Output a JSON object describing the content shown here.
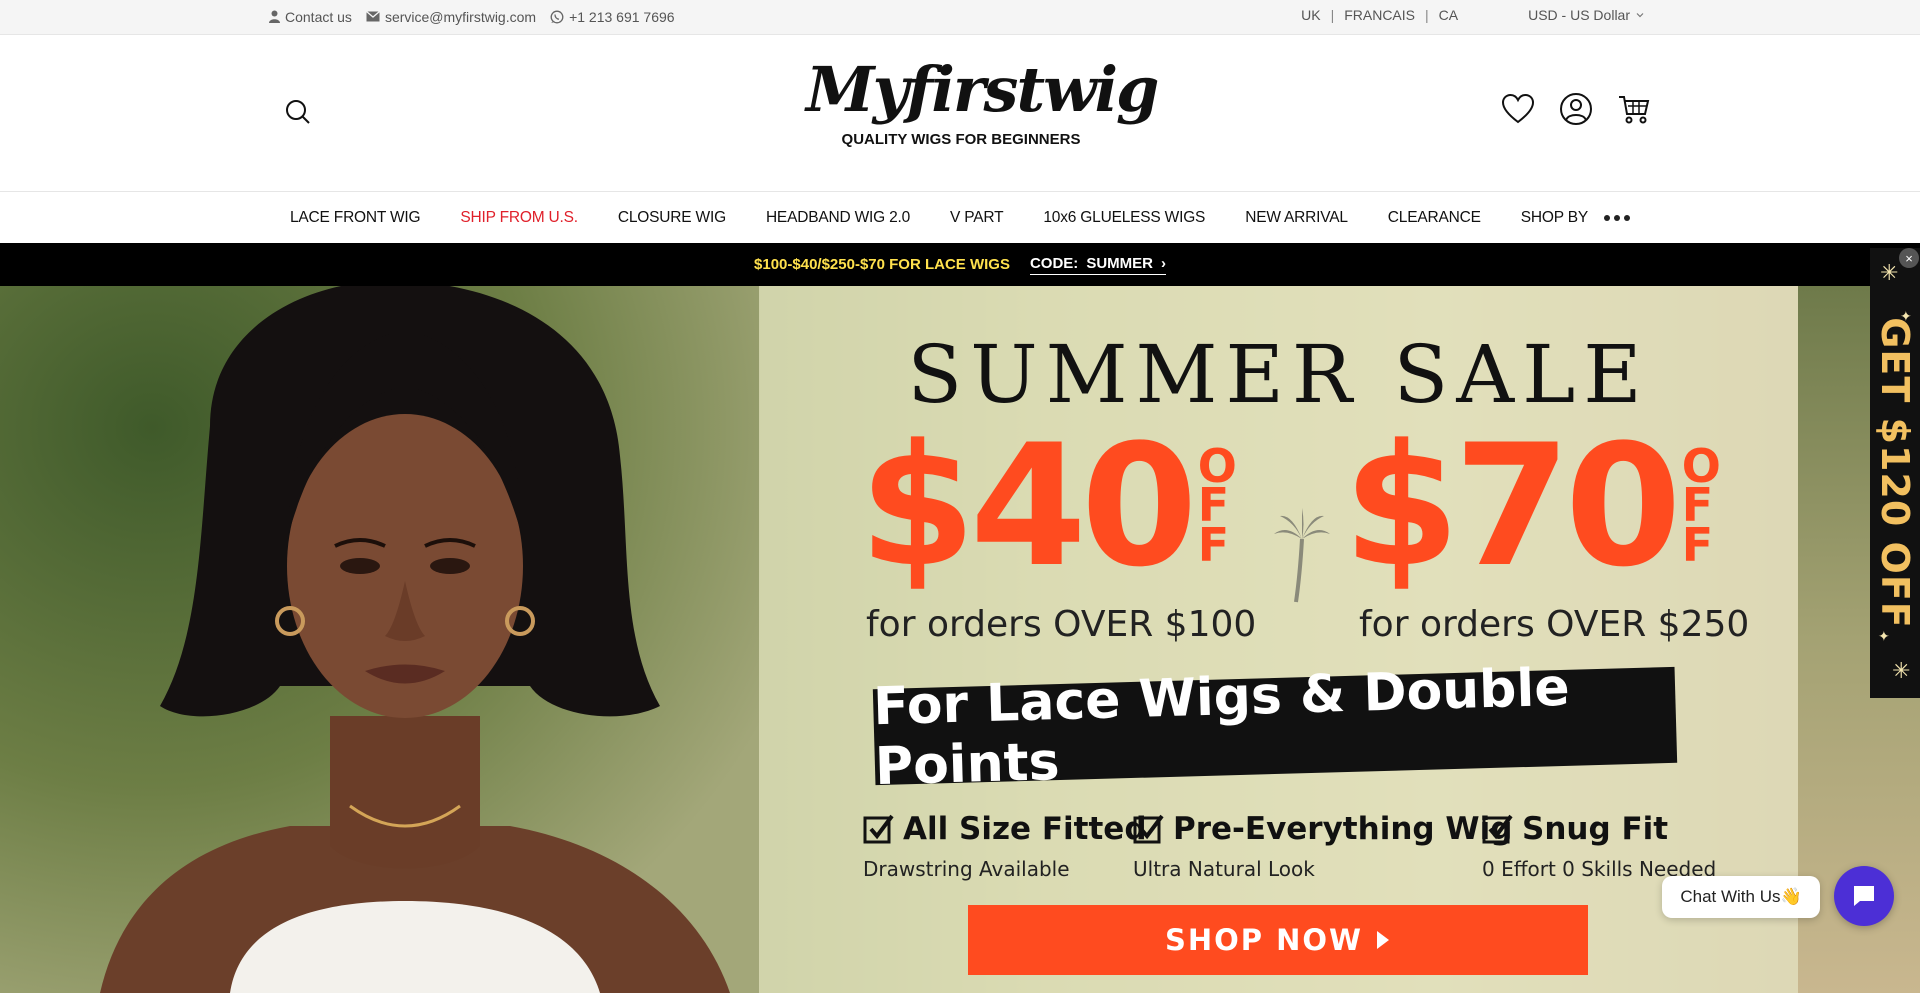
{
  "topbar": {
    "contact_label": "Contact us",
    "email": "service@myfirstwig.com",
    "phone": "+1 213 691 7696",
    "regions": [
      "UK",
      "FRANCAIS",
      "CA"
    ],
    "separator": "|",
    "currency": "USD - US Dollar"
  },
  "header": {
    "logo_text": "Myfirstwig",
    "logo_tagline": "QUALITY WIGS FOR BEGINNERS",
    "icons": [
      "search-icon",
      "heart-icon",
      "user-icon",
      "cart-icon"
    ]
  },
  "nav": {
    "items": [
      {
        "label": "LACE FRONT WIG",
        "highlight": false
      },
      {
        "label": "SHIP FROM U.S.",
        "highlight": true
      },
      {
        "label": "CLOSURE WIG",
        "highlight": false
      },
      {
        "label": "HEADBAND WIG 2.0",
        "highlight": false
      },
      {
        "label": "V PART",
        "highlight": false
      },
      {
        "label": "10x6 GLUELESS WIGS",
        "highlight": false
      },
      {
        "label": "NEW ARRIVAL",
        "highlight": false
      },
      {
        "label": "CLEARANCE",
        "highlight": false
      },
      {
        "label": "SHOP BY",
        "highlight": false
      }
    ],
    "highlight_color": "#e0202a"
  },
  "promo": {
    "deal": "$100-$40/$250-$70 FOR LACE WIGS",
    "code_label": "CODE:",
    "code_value": "SUMMER",
    "arrow": "›",
    "deal_color": "#ffe14d"
  },
  "hero": {
    "title": "SUMMER SALE",
    "offers": [
      {
        "amount": "$40",
        "off": [
          "O",
          "F",
          "F"
        ],
        "condition": "for orders OVER $100"
      },
      {
        "amount": "$70",
        "off": [
          "O",
          "F",
          "F"
        ],
        "condition": "for orders OVER $250"
      }
    ],
    "banner": "For Lace Wigs & Double Points",
    "features": [
      {
        "title": "All Size Fitted",
        "subtitle": "Drawstring Available"
      },
      {
        "title": "Pre-Everything Wig",
        "subtitle": "Ultra Natural Look"
      },
      {
        "title": "Snug Fit",
        "subtitle": "0 Effort 0 Skills Needed"
      }
    ],
    "cta": "SHOP NOW",
    "accent_color": "#ff4b1f"
  },
  "side_tab": {
    "text": "GET $120 OFF",
    "close": "×"
  },
  "chat": {
    "bubble": "Chat With Us👋"
  }
}
